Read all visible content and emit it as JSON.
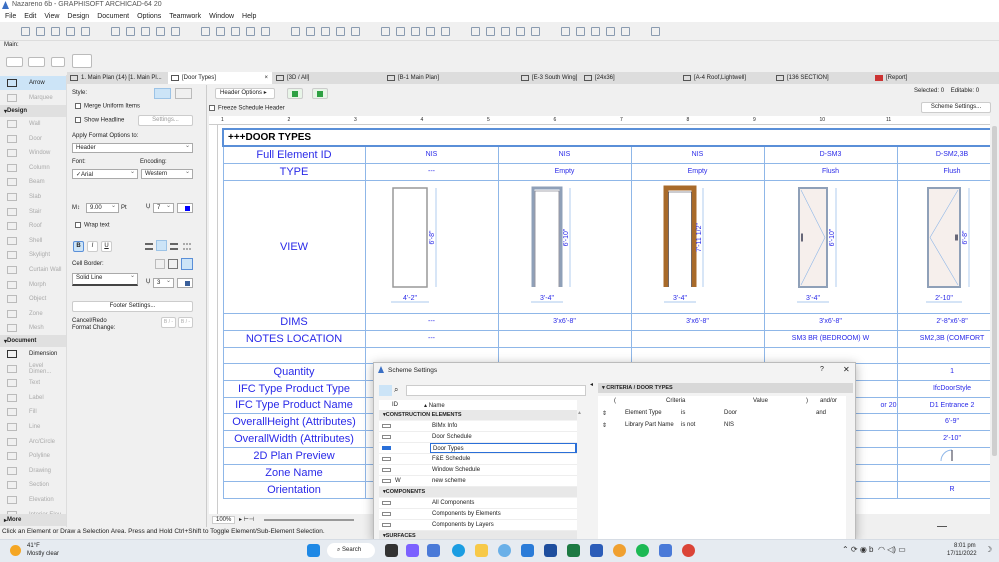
{
  "app": {
    "title": "Nazareno 6b - GRAPHISOFT ARCHICAD-64 20",
    "menu": [
      "File",
      "Edit",
      "View",
      "Design",
      "Document",
      "Options",
      "Teamwork",
      "Window",
      "Help"
    ],
    "toolbar_label": "Main:"
  },
  "tabs": [
    {
      "label": "1. Main Plan (14) [1. Main Pl...",
      "icon": "floor-plan-icon"
    },
    {
      "label": "[Door Types]",
      "icon": "schedule-icon",
      "active": true
    },
    {
      "label": "[3D / All]",
      "icon": "cube-icon"
    },
    {
      "label": "[B-1 Main Plan]",
      "icon": "layout-icon"
    },
    {
      "label": "[E-3 South Wing]",
      "icon": "layout-icon"
    },
    {
      "label": "[24x36]",
      "icon": "master-layout-icon"
    },
    {
      "label": "[A-4 Roof,Lightwell]",
      "icon": "layout-icon"
    },
    {
      "label": "[136 SECTION]",
      "icon": "folder-icon"
    },
    {
      "label": "[Report]",
      "icon": "report-icon"
    }
  ],
  "toolbox": {
    "arrow": "Arrow",
    "marquee": "Marquee",
    "design_header": "Design",
    "design": [
      "Wall",
      "Door",
      "Window",
      "Column",
      "Beam",
      "Slab",
      "Stair",
      "Roof",
      "Shell",
      "Skylight",
      "Curtain Wall",
      "Morph",
      "Object",
      "Zone",
      "Mesh"
    ],
    "document_header": "Document",
    "document": [
      "Dimension",
      "Level Dimen...",
      "Text",
      "Label",
      "Fill",
      "Line",
      "Arc/Circle",
      "Polyline",
      "Drawing",
      "Section",
      "Elevation",
      "Interior Elev..."
    ],
    "more": "More"
  },
  "info": {
    "style": "Style:",
    "merge": "Merge Uniform Items",
    "show_headline": "Show Headline",
    "settings": "Settings...",
    "apply_format": "Apply Format Options to:",
    "apply_value": "Header",
    "font": "Font:",
    "font_value": "✓Arial",
    "encoding": "Encoding:",
    "encoding_value": "Western",
    "size": "9.00",
    "pt": "Pt",
    "pen": "7",
    "wrap": "Wrap text",
    "bold": "B",
    "italic": "I",
    "underline": "U",
    "cell_border": "Cell Border:",
    "line_type": "Solid Line",
    "border_pen": "3",
    "footer": "Footer Settings...",
    "cancel_redo": "Cancel/Redo",
    "format_change": "Format Change:",
    "undo_label": "B / -",
    "redo_label": "B / -",
    "pen_color": "#0000ff",
    "border_color": "#3a5f9a"
  },
  "header_bar": {
    "header_options": "Header Options",
    "freeze": "Freeze Schedule Header",
    "selected_label": "Selected:",
    "selected": "0",
    "editable_label": "Editable:",
    "editable": "0",
    "scheme_settings": "Scheme Settings..."
  },
  "ruler": [
    "1",
    "2",
    "3",
    "4",
    "5",
    "6",
    "7",
    "8",
    "9",
    "10",
    "11"
  ],
  "schedule": {
    "title": "+++DOOR TYPES",
    "rows": [
      {
        "label": "Full Element ID",
        "cells": [
          "NIS",
          "NIS",
          "NIS",
          "D-SM3",
          "D-SM2,3B"
        ]
      },
      {
        "label": "TYPE",
        "cells": [
          "---",
          "Empty",
          "Empty",
          "Flush",
          "Flush"
        ]
      },
      {
        "label": "VIEW",
        "view": true
      },
      {
        "label": "DIMS",
        "cells": [
          "---",
          "3'x6'-8\"",
          "3'x6'-8\"",
          "3'x6'-8\"",
          "2'-8\"x6'-8\""
        ]
      },
      {
        "label": "NOTES LOCATION",
        "cells": [
          "---",
          "",
          "",
          "SM3 BR (BEDROOM) W",
          "SM2,3B (COMFORT"
        ]
      },
      {
        "label": "",
        "cells": [
          "",
          "",
          "",
          "",
          ""
        ]
      },
      {
        "label": "Quantity",
        "cells": [
          "",
          "",
          "",
          "",
          "1"
        ]
      },
      {
        "label": "IFC Type Product Type",
        "cells": [
          "",
          "",
          "",
          "",
          "IfcDoorStyle"
        ]
      },
      {
        "label": "IFC Type Product Name",
        "cells": [
          "",
          "",
          "",
          "or 20",
          "D1 Entrance 2"
        ]
      },
      {
        "label": "OverallHeight (Attributes)",
        "cells": [
          "",
          "",
          "",
          "",
          "6'-9\""
        ]
      },
      {
        "label": "OverallWidth (Attributes)",
        "cells": [
          "",
          "",
          "",
          "",
          "2'-10\""
        ]
      },
      {
        "label": "2D Plan Preview",
        "cells": [
          "",
          "",
          "",
          "",
          ""
        ],
        "plan": true
      },
      {
        "label": "Zone Name",
        "cells": [
          "",
          "",
          "",
          "",
          ""
        ]
      },
      {
        "label": "Orientation",
        "cells": [
          "",
          "",
          "",
          "",
          "R"
        ]
      }
    ],
    "views": [
      {
        "style": "plain",
        "w": "4'-2\"",
        "h": "6'-8\""
      },
      {
        "style": "frame",
        "w": "3'-4\"",
        "h": "6'-10\""
      },
      {
        "style": "wood",
        "w": "3'-4\"",
        "h": "7'-11 1/2\""
      },
      {
        "style": "panel-left",
        "w": "3'-4\"",
        "h": "6'-10\""
      },
      {
        "style": "panel-right",
        "w": "2'-10\"",
        "h": "6'-8\""
      }
    ]
  },
  "zoom": "100%",
  "status": "Click an Element or Draw a Selection Area. Press and Hold Ctrl+Shift to Toggle Element/Sub-Element Selection.",
  "dialog": {
    "title": "Scheme Settings",
    "help": "?",
    "close": "✕",
    "col_id": "ID",
    "col_name": "Name",
    "sections": [
      {
        "name": "CONSTRUCTION ELEMENTS",
        "items": [
          {
            "id": "",
            "name": "BIMx Info"
          },
          {
            "id": "",
            "name": "Door Schedule"
          },
          {
            "id": "",
            "name": "Door Types",
            "selected": true
          },
          {
            "id": "",
            "name": "F&E Schedule"
          },
          {
            "id": "",
            "name": "Window Schedule"
          },
          {
            "id": "W",
            "name": "new scheme"
          }
        ]
      },
      {
        "name": "COMPONENTS",
        "items": [
          {
            "id": "",
            "name": "All Components"
          },
          {
            "id": "",
            "name": "Components by Elements"
          },
          {
            "id": "",
            "name": "Components by Layers"
          }
        ]
      },
      {
        "name": "SURFACES",
        "items": []
      }
    ],
    "criteria_header": "CRITERIA /  DOOR TYPES",
    "crit_cols": [
      "(",
      "Criteria",
      "Value",
      ")",
      "and/or"
    ],
    "criteria": [
      {
        "criteria": "Element Type",
        "op": "is",
        "value": "Door",
        "andor": "and"
      },
      {
        "criteria": "Library Part Name",
        "op": "is not",
        "value": "NIS",
        "andor": ""
      }
    ]
  },
  "taskbar": {
    "temp": "41°F",
    "weather": "Mostly clear",
    "search": "Search",
    "time": "8:01 pm",
    "date": "17/11/2022"
  }
}
